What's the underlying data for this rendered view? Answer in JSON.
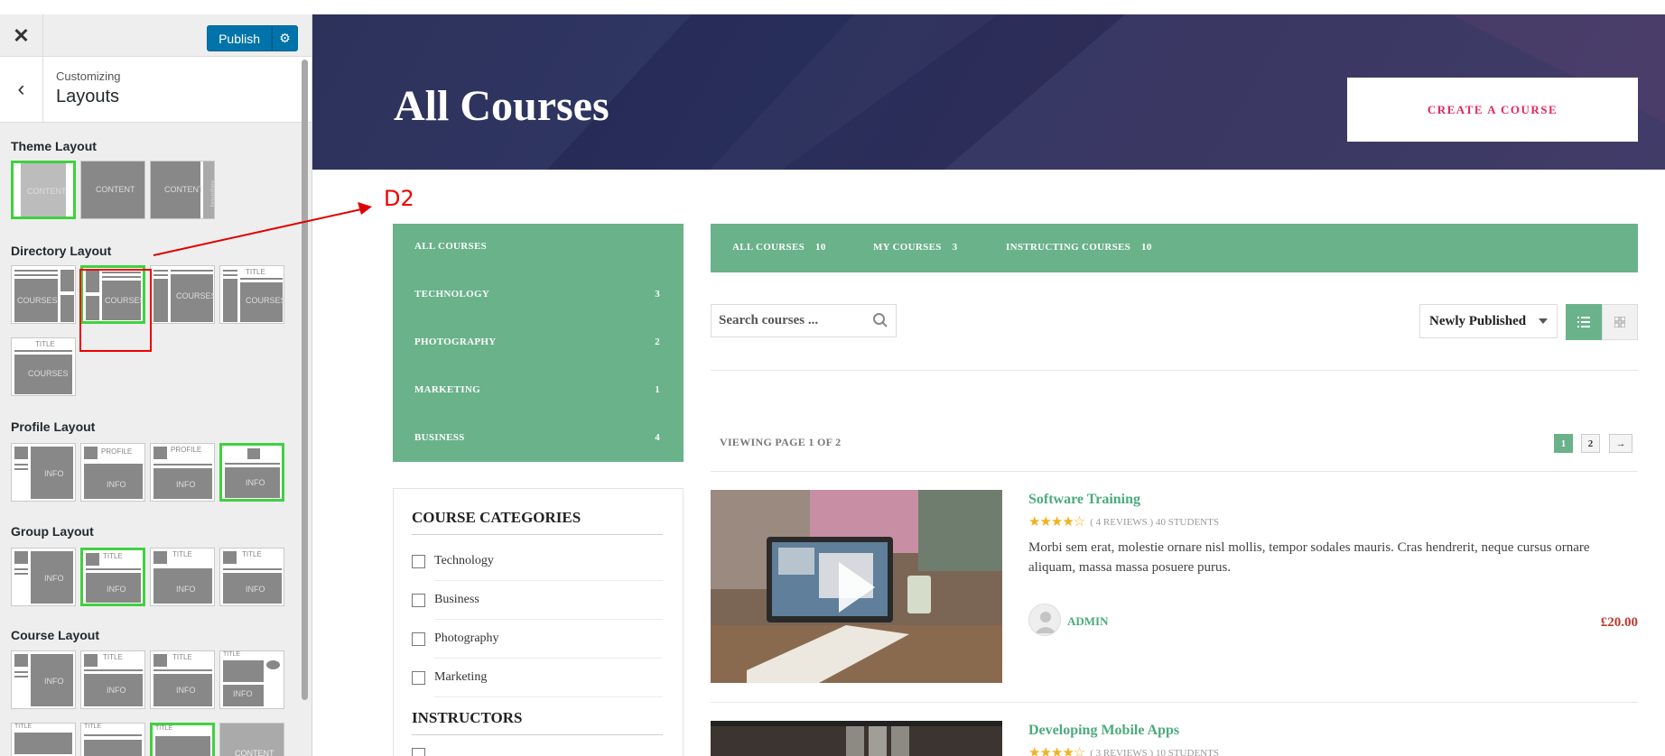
{
  "customizer": {
    "close_icon": "close-icon",
    "publish_label": "Publish",
    "breadcrumb": "Customizing",
    "section_title": "Layouts",
    "groups": {
      "theme": "Theme Layout",
      "directory": "Directory Layout",
      "profile": "Profile Layout",
      "group": "Group Layout",
      "course": "Course Layout"
    },
    "thumb_text": {
      "content": "CONTENT",
      "courses": "COURSES",
      "title": "TITLE",
      "profile": "PROFILE",
      "info": "INFO",
      "boundary": "boundary"
    },
    "selection_color": "#3fd13f"
  },
  "annotation": {
    "label": "D2",
    "color": "#e00000"
  },
  "hero": {
    "title": "All Courses",
    "create_button": "CREATE A COURSE"
  },
  "category_menu": [
    {
      "label": "ALL COURSES",
      "count": ""
    },
    {
      "label": "TECHNOLOGY",
      "count": "3"
    },
    {
      "label": "PHOTOGRAPHY",
      "count": "2"
    },
    {
      "label": "MARKETING",
      "count": "1"
    },
    {
      "label": "BUSINESS",
      "count": "4"
    }
  ],
  "tabs": [
    {
      "label": "ALL COURSES",
      "count": "10"
    },
    {
      "label": "MY COURSES",
      "count": "3"
    },
    {
      "label": "INSTRUCTING COURSES",
      "count": "10"
    }
  ],
  "search": {
    "placeholder": "Search courses ..."
  },
  "sort": {
    "selected": "Newly Published"
  },
  "pagination": {
    "viewing": "VIEWING PAGE 1 OF 2",
    "pages": [
      "1",
      "2"
    ],
    "next": "→"
  },
  "widget": {
    "categories_title": "COURSE CATEGORIES",
    "categories": [
      "Technology",
      "Business",
      "Photography",
      "Marketing"
    ],
    "instructors_title": "INSTRUCTORS"
  },
  "courses": [
    {
      "title": "Software Training",
      "stars": "★★★★☆",
      "reviews": "( 4 REVIEWS )",
      "students": "40 STUDENTS",
      "description": "Morbi sem erat, molestie ornare nisl mollis, tempor sodales mauris. Cras hendrerit, neque cursus ornare aliquam, massa massa posuere purus.",
      "author": "ADMIN",
      "price": "£20.00"
    },
    {
      "title": "Developing Mobile Apps",
      "stars": "★★★★☆",
      "reviews": "( 3 REVIEWS )",
      "students": "10 STUDENTS"
    }
  ],
  "colors": {
    "accent_green": "#69b28a",
    "link_green": "#4bab7c",
    "cta_pink": "#e8245b",
    "price_red": "#c0392b",
    "wp_blue": "#0073aa",
    "hero_navy": "#2b3160"
  }
}
